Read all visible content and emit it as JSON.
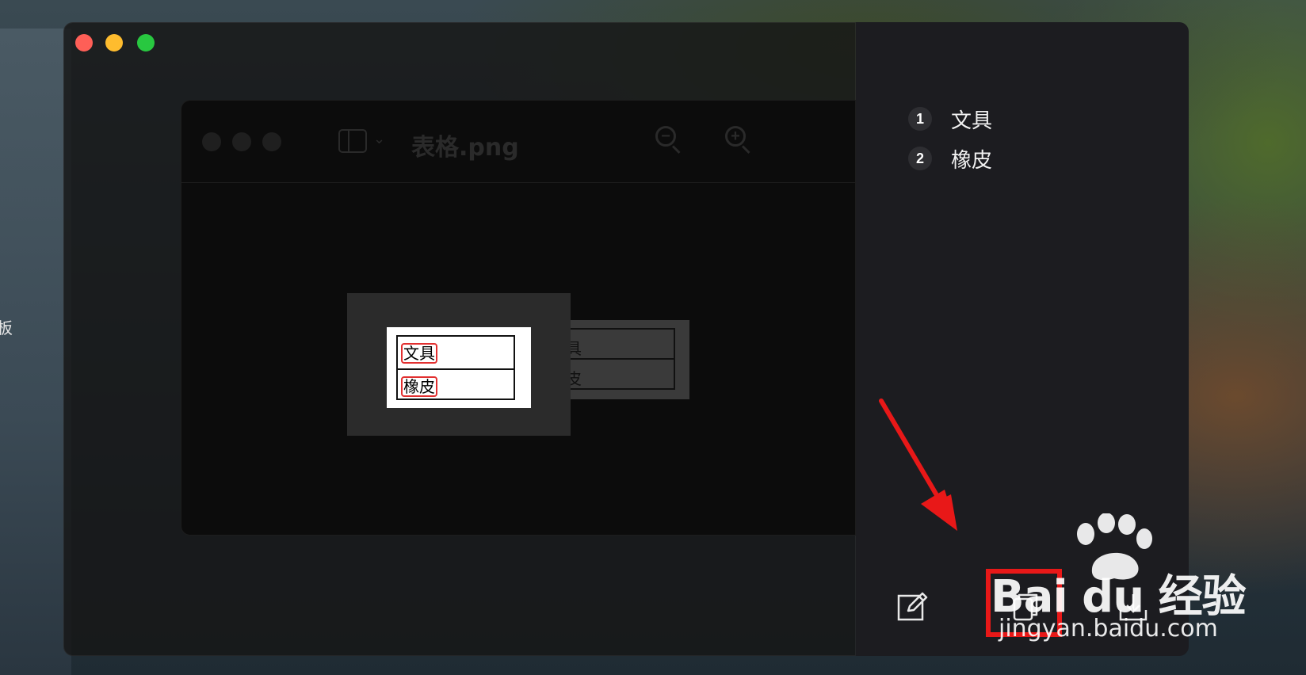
{
  "desktop": {
    "edge_text": "板"
  },
  "preview_window": {
    "title": "表格.png",
    "sidebar_chevron": "⌄"
  },
  "captured_image": {
    "rows": [
      "文具",
      "橡皮"
    ]
  },
  "background_table": {
    "rows": [
      "文具",
      "橡皮"
    ]
  },
  "ocr_panel": {
    "results": [
      {
        "index": "1",
        "text": "文具"
      },
      {
        "index": "2",
        "text": "橡皮"
      }
    ],
    "actions": [
      {
        "name": "edit",
        "icon": "edit-icon"
      },
      {
        "name": "copy",
        "icon": "copy-icon"
      },
      {
        "name": "save",
        "icon": "download-icon"
      }
    ]
  },
  "annotation": {
    "highlight_color": "#e81818",
    "arrow_color": "#e81818"
  },
  "watermark": {
    "main_text": "Bai du 经验",
    "sub_text": "jingyan.baidu.com"
  }
}
